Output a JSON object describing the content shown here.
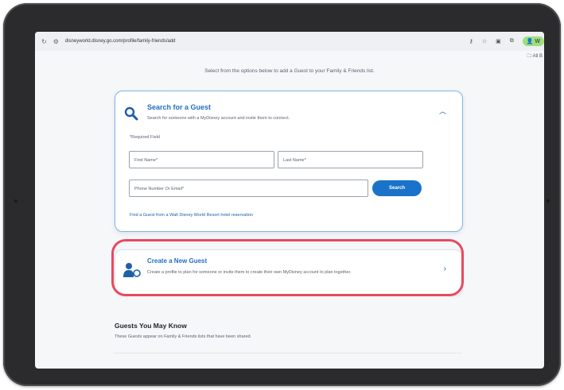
{
  "browser": {
    "url": "disneyworld.disney.go.com/profile/family-friends/add",
    "profile_label": "W",
    "bookmarks_label": "All B"
  },
  "page": {
    "intro": "Select from the options below to add a Guest to your Family & Friends list."
  },
  "search_card": {
    "title": "Search for a Guest",
    "subtitle": "Search for someone with a MyDisney account and invite them to connect.",
    "required_note": "*Required Field",
    "first_name_placeholder": "First Name*",
    "last_name_placeholder": "Last Name*",
    "phone_placeholder": "Phone Number Or Email*",
    "search_button": "Search",
    "find_link": "Find a Guest from a Walt Disney World Resort hotel reservation"
  },
  "create_card": {
    "title": "Create a New Guest",
    "subtitle": "Create a profile to plan for someone or invite them to create their own MyDisney account to plan together."
  },
  "guests_may_know": {
    "title": "Guests You May Know",
    "subtitle": "These Guests appear on Family & Friends lists that have been shared."
  },
  "colors": {
    "brand_blue": "#1f6fc5",
    "button_blue": "#1a73c9",
    "highlight_red": "#e8495f"
  }
}
